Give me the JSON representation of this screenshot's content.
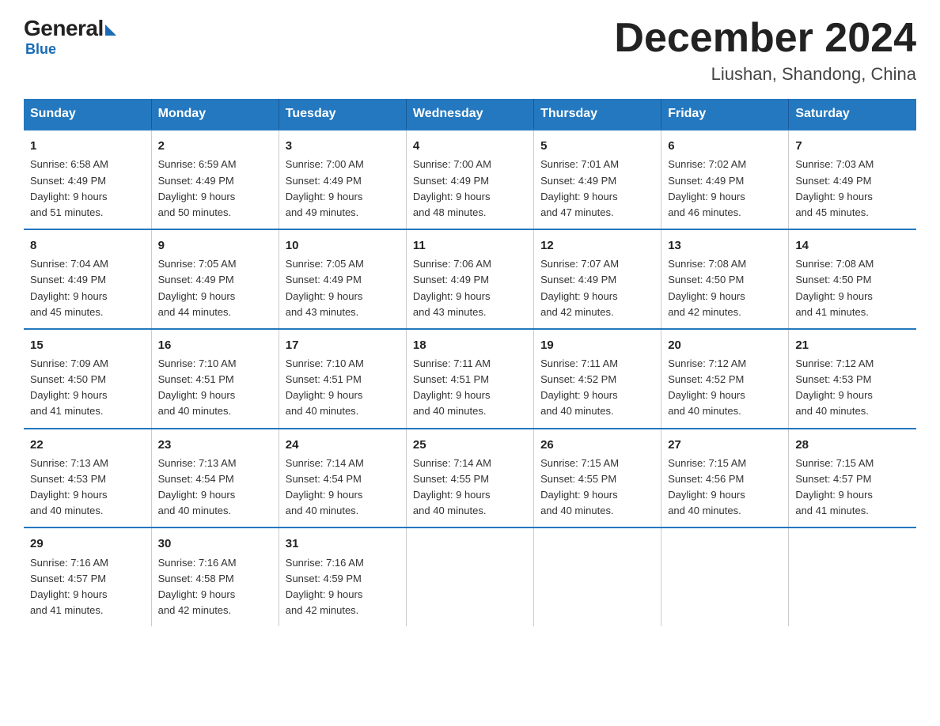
{
  "header": {
    "logo_general": "General",
    "logo_blue": "Blue",
    "month_title": "December 2024",
    "location": "Liushan, Shandong, China"
  },
  "weekdays": [
    "Sunday",
    "Monday",
    "Tuesday",
    "Wednesday",
    "Thursday",
    "Friday",
    "Saturday"
  ],
  "weeks": [
    [
      {
        "day": "1",
        "sunrise": "6:58 AM",
        "sunset": "4:49 PM",
        "daylight": "9 hours and 51 minutes."
      },
      {
        "day": "2",
        "sunrise": "6:59 AM",
        "sunset": "4:49 PM",
        "daylight": "9 hours and 50 minutes."
      },
      {
        "day": "3",
        "sunrise": "7:00 AM",
        "sunset": "4:49 PM",
        "daylight": "9 hours and 49 minutes."
      },
      {
        "day": "4",
        "sunrise": "7:00 AM",
        "sunset": "4:49 PM",
        "daylight": "9 hours and 48 minutes."
      },
      {
        "day": "5",
        "sunrise": "7:01 AM",
        "sunset": "4:49 PM",
        "daylight": "9 hours and 47 minutes."
      },
      {
        "day": "6",
        "sunrise": "7:02 AM",
        "sunset": "4:49 PM",
        "daylight": "9 hours and 46 minutes."
      },
      {
        "day": "7",
        "sunrise": "7:03 AM",
        "sunset": "4:49 PM",
        "daylight": "9 hours and 45 minutes."
      }
    ],
    [
      {
        "day": "8",
        "sunrise": "7:04 AM",
        "sunset": "4:49 PM",
        "daylight": "9 hours and 45 minutes."
      },
      {
        "day": "9",
        "sunrise": "7:05 AM",
        "sunset": "4:49 PM",
        "daylight": "9 hours and 44 minutes."
      },
      {
        "day": "10",
        "sunrise": "7:05 AM",
        "sunset": "4:49 PM",
        "daylight": "9 hours and 43 minutes."
      },
      {
        "day": "11",
        "sunrise": "7:06 AM",
        "sunset": "4:49 PM",
        "daylight": "9 hours and 43 minutes."
      },
      {
        "day": "12",
        "sunrise": "7:07 AM",
        "sunset": "4:49 PM",
        "daylight": "9 hours and 42 minutes."
      },
      {
        "day": "13",
        "sunrise": "7:08 AM",
        "sunset": "4:50 PM",
        "daylight": "9 hours and 42 minutes."
      },
      {
        "day": "14",
        "sunrise": "7:08 AM",
        "sunset": "4:50 PM",
        "daylight": "9 hours and 41 minutes."
      }
    ],
    [
      {
        "day": "15",
        "sunrise": "7:09 AM",
        "sunset": "4:50 PM",
        "daylight": "9 hours and 41 minutes."
      },
      {
        "day": "16",
        "sunrise": "7:10 AM",
        "sunset": "4:51 PM",
        "daylight": "9 hours and 40 minutes."
      },
      {
        "day": "17",
        "sunrise": "7:10 AM",
        "sunset": "4:51 PM",
        "daylight": "9 hours and 40 minutes."
      },
      {
        "day": "18",
        "sunrise": "7:11 AM",
        "sunset": "4:51 PM",
        "daylight": "9 hours and 40 minutes."
      },
      {
        "day": "19",
        "sunrise": "7:11 AM",
        "sunset": "4:52 PM",
        "daylight": "9 hours and 40 minutes."
      },
      {
        "day": "20",
        "sunrise": "7:12 AM",
        "sunset": "4:52 PM",
        "daylight": "9 hours and 40 minutes."
      },
      {
        "day": "21",
        "sunrise": "7:12 AM",
        "sunset": "4:53 PM",
        "daylight": "9 hours and 40 minutes."
      }
    ],
    [
      {
        "day": "22",
        "sunrise": "7:13 AM",
        "sunset": "4:53 PM",
        "daylight": "9 hours and 40 minutes."
      },
      {
        "day": "23",
        "sunrise": "7:13 AM",
        "sunset": "4:54 PM",
        "daylight": "9 hours and 40 minutes."
      },
      {
        "day": "24",
        "sunrise": "7:14 AM",
        "sunset": "4:54 PM",
        "daylight": "9 hours and 40 minutes."
      },
      {
        "day": "25",
        "sunrise": "7:14 AM",
        "sunset": "4:55 PM",
        "daylight": "9 hours and 40 minutes."
      },
      {
        "day": "26",
        "sunrise": "7:15 AM",
        "sunset": "4:55 PM",
        "daylight": "9 hours and 40 minutes."
      },
      {
        "day": "27",
        "sunrise": "7:15 AM",
        "sunset": "4:56 PM",
        "daylight": "9 hours and 40 minutes."
      },
      {
        "day": "28",
        "sunrise": "7:15 AM",
        "sunset": "4:57 PM",
        "daylight": "9 hours and 41 minutes."
      }
    ],
    [
      {
        "day": "29",
        "sunrise": "7:16 AM",
        "sunset": "4:57 PM",
        "daylight": "9 hours and 41 minutes."
      },
      {
        "day": "30",
        "sunrise": "7:16 AM",
        "sunset": "4:58 PM",
        "daylight": "9 hours and 42 minutes."
      },
      {
        "day": "31",
        "sunrise": "7:16 AM",
        "sunset": "4:59 PM",
        "daylight": "9 hours and 42 minutes."
      },
      null,
      null,
      null,
      null
    ]
  ]
}
